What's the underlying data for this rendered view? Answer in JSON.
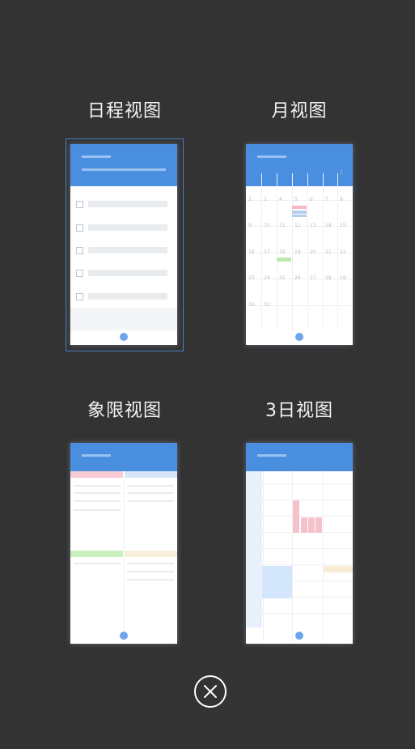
{
  "views": {
    "schedule": {
      "label": "日程视图"
    },
    "month": {
      "label": "月视图",
      "days": [
        "1",
        "2",
        "3",
        "4",
        "5",
        "6",
        "7",
        "8",
        "9",
        "10",
        "11",
        "12",
        "13",
        "14",
        "15",
        "16",
        "17",
        "18",
        "19",
        "20",
        "21",
        "22",
        "23",
        "24",
        "25",
        "26",
        "27",
        "28",
        "29",
        "30",
        "31"
      ]
    },
    "quadrant": {
      "label": "象限视图"
    },
    "threeday": {
      "label": "3日视图"
    }
  },
  "colors": {
    "background": "#333333",
    "header_blue": "#4a8ee0",
    "selection_border": "#4a7fc0"
  },
  "close_icon": "close-icon"
}
